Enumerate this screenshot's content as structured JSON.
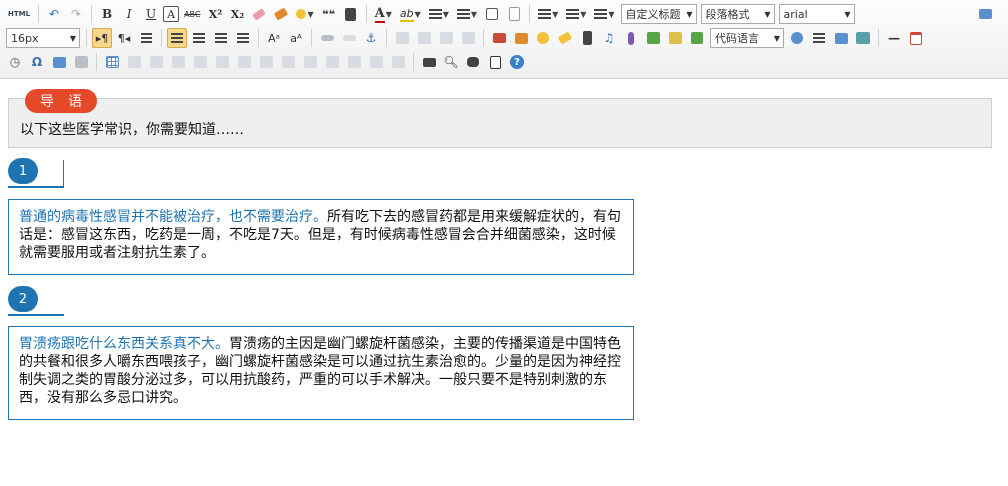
{
  "toolbar": {
    "html_label": "HTML",
    "bold": "B",
    "italic": "I",
    "underline": "U",
    "font_border": "A",
    "strikethrough": "ABC",
    "superscript": "X²",
    "subscript": "X₂",
    "quote": "❝❝",
    "font_color": "A",
    "highlight": "ab",
    "custom_heading": "自定义标题",
    "paragraph_format": "段落格式",
    "font_family": "arial",
    "font_size": "16px",
    "code_language": "代码语言",
    "omega": "Ω"
  },
  "intro": {
    "badge": "导语",
    "text": "以下这些医学常识，你需要知道……"
  },
  "sections": [
    {
      "number": "1",
      "highlight": "普通的病毒性感冒并不能被治疗，也不需要治疗。",
      "body": "所有吃下去的感冒药都是用来缓解症状的，有句话是：感冒这东西，吃药是一周，不吃是7天。但是，有时候病毒性感冒会合并细菌感染，这时候就需要服用或者注射抗生素了。"
    },
    {
      "number": "2",
      "highlight": "胃溃疡跟吃什么东西关系真不大。",
      "body": "胃溃疡的主因是幽门螺旋杆菌感染，主要的传播渠道是中国特色的共餐和很多人嚼东西喂孩子，幽门螺旋杆菌感染是可以通过抗生素治愈的。少量的是因为神经控制失调之类的胃酸分泌过多，可以用抗酸药，严重的可以手术解决。一般只要不是特别刺激的东西，没有那么多忌口讲究。"
    }
  ]
}
